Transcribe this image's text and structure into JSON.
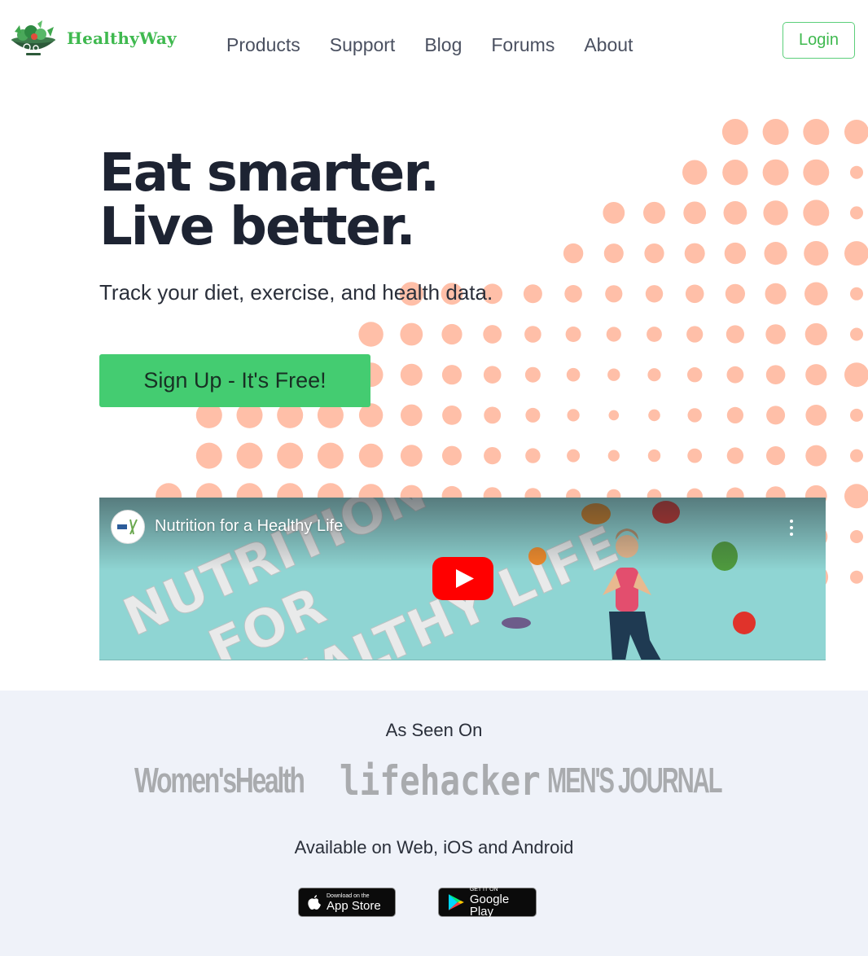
{
  "brand": {
    "name": "HealthyWay",
    "color": "#3fb94f"
  },
  "nav": {
    "items": [
      {
        "label": "Products"
      },
      {
        "label": "Support"
      },
      {
        "label": "Blog"
      },
      {
        "label": "Forums"
      },
      {
        "label": "About"
      }
    ],
    "login_label": "Login"
  },
  "hero": {
    "title_line1": "Eat smarter.",
    "title_line2": "Live better.",
    "subtitle": "Track your diet, exercise, and health data.",
    "cta_label": "Sign Up - It's Free!",
    "cta_color": "#44cc71",
    "dot_color": "#ffbfa8"
  },
  "video": {
    "title": "Nutrition for a Healthy Life",
    "art_text": "NUTRITION FOR A HEALTHY LIFE",
    "icons": [
      "channel-avatar-icon",
      "more-vert-icon",
      "youtube-play-icon"
    ]
  },
  "press": {
    "heading": "As Seen On",
    "logos": [
      "Women'sHealth",
      "lifehacker",
      "MEN'S JOURNAL"
    ]
  },
  "platforms": {
    "heading": "Available on Web, iOS and Android",
    "app_store": {
      "small": "Download on the",
      "big": "App Store"
    },
    "google_play": {
      "small": "GET IT ON",
      "big": "Google Play"
    }
  }
}
